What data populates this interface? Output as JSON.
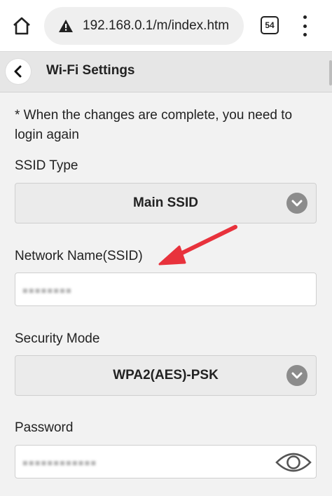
{
  "browser": {
    "url": "192.168.0.1/m/index.htm",
    "tab_count": "54",
    "icons": {
      "home": "home-icon",
      "warning": "warning-icon",
      "menu": "more-vert-icon"
    }
  },
  "header": {
    "title": "Wi-Fi Settings",
    "back_icon": "chevron-left-icon"
  },
  "form": {
    "note": "* When the changes are complete, you need to login again",
    "ssid_type": {
      "label": "SSID Type",
      "value": "Main SSID"
    },
    "network_name": {
      "label": "Network Name(SSID)",
      "value": "■■■■■■■■"
    },
    "security_mode": {
      "label": "Security Mode",
      "value": "WPA2(AES)-PSK"
    },
    "password": {
      "label": "Password",
      "value": "■■■■■■■■■■■■"
    }
  },
  "colors": {
    "annotation_arrow": "#e8323c",
    "chevron_circle": "#8c8c8c",
    "header_bg": "#e6e6e6"
  }
}
